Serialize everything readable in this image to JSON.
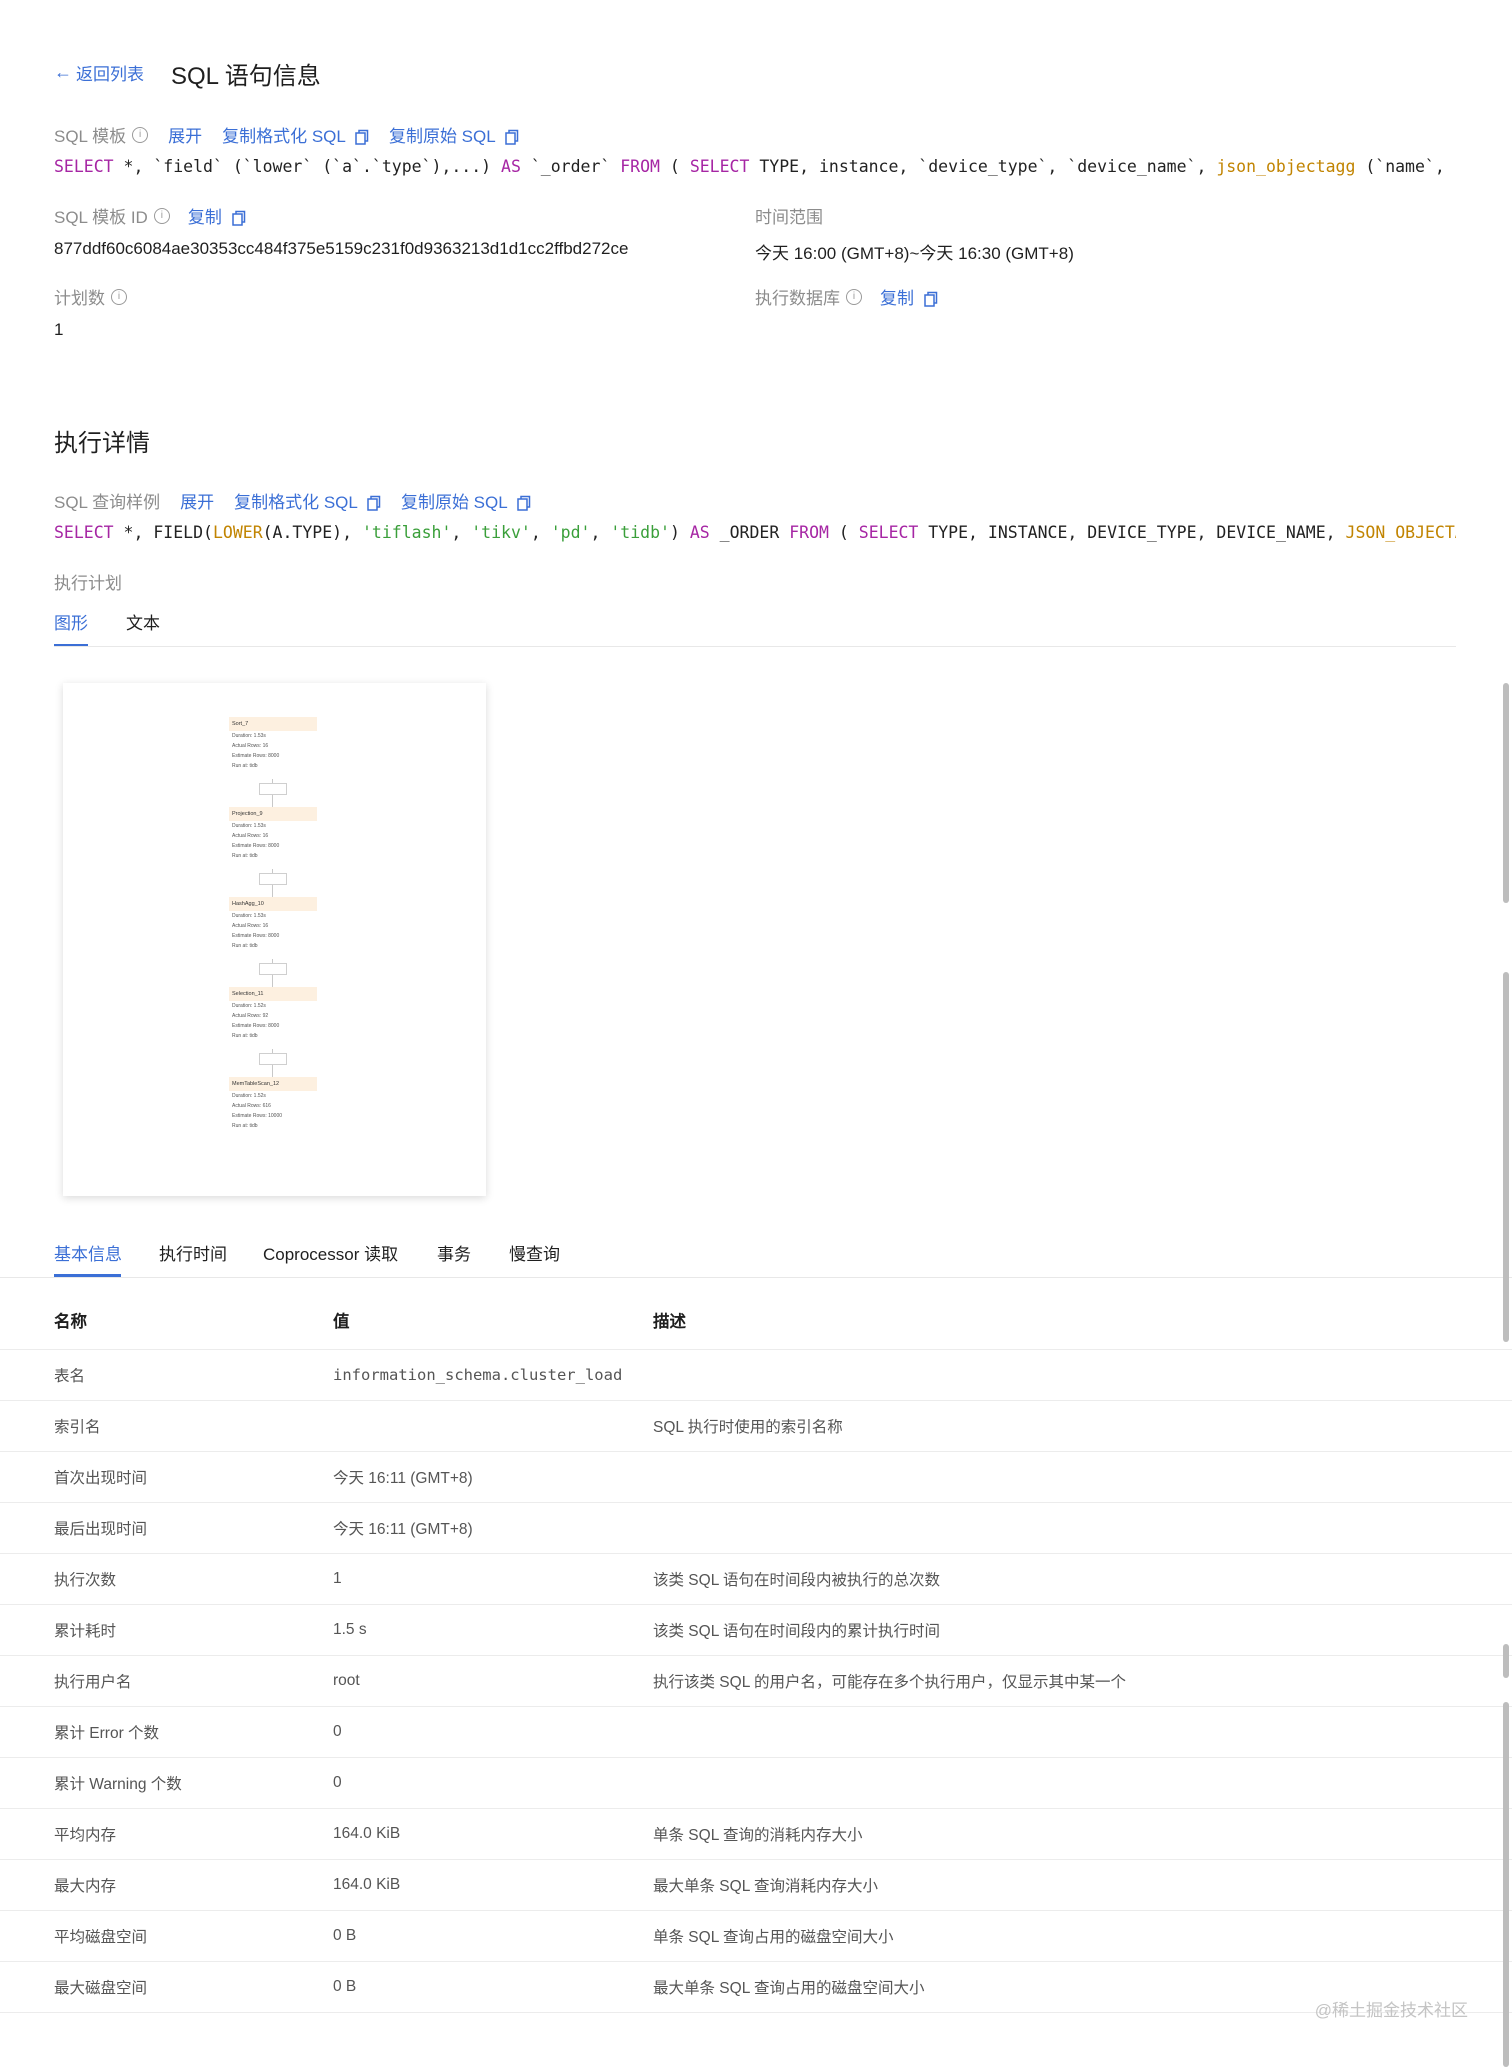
{
  "header": {
    "back_label": "返回列表",
    "title": "SQL 语句信息"
  },
  "template": {
    "label": "SQL 模板",
    "expand": "展开",
    "copy_formatted": "复制格式化 SQL",
    "copy_raw": "复制原始 SQL"
  },
  "template_sql": [
    {
      "t": "SELECT",
      "c": "kw"
    },
    {
      "t": " *, `field` (`lower` (`a`.`type`),...) ",
      "c": ""
    },
    {
      "t": "AS",
      "c": "kw"
    },
    {
      "t": " `_order` ",
      "c": ""
    },
    {
      "t": "FROM",
      "c": "kw"
    },
    {
      "t": " ( ",
      "c": ""
    },
    {
      "t": "SELECT",
      "c": "kw"
    },
    {
      "t": " TYPE, instance, `device_type`, `device_name`, ",
      "c": ""
    },
    {
      "t": "json_objectagg",
      "c": "fn"
    },
    {
      "t": " (`name`, ",
      "c": ""
    }
  ],
  "meta": {
    "template_id_label": "SQL 模板 ID",
    "template_id_copy": "复制",
    "template_id_value": "877ddf60c6084ae30353cc484f375e5159c231f0d9363213d1d1cc2ffbd272ce",
    "time_range_label": "时间范围",
    "time_range_value": "今天 16:00 (GMT+8)~今天 16:30 (GMT+8)",
    "plan_count_label": "计划数",
    "plan_count_value": "1",
    "exec_db_label": "执行数据库",
    "exec_db_copy": "复制"
  },
  "detail": {
    "title": "执行详情",
    "sample_label": "SQL 查询样例",
    "expand": "展开",
    "copy_formatted": "复制格式化 SQL",
    "copy_raw": "复制原始 SQL",
    "plan_label": "执行计划",
    "tab_graph": "图形",
    "tab_text": "文本"
  },
  "sample_sql": [
    {
      "t": "SELECT",
      "c": "kw"
    },
    {
      "t": " *, FIELD(",
      "c": ""
    },
    {
      "t": "LOWER",
      "c": "fn"
    },
    {
      "t": "(A.TYPE), ",
      "c": ""
    },
    {
      "t": "'tiflash'",
      "c": "str"
    },
    {
      "t": ", ",
      "c": ""
    },
    {
      "t": "'tikv'",
      "c": "str"
    },
    {
      "t": ", ",
      "c": ""
    },
    {
      "t": "'pd'",
      "c": "str"
    },
    {
      "t": ", ",
      "c": ""
    },
    {
      "t": "'tidb'",
      "c": "str"
    },
    {
      "t": ") ",
      "c": ""
    },
    {
      "t": "AS",
      "c": "kw"
    },
    {
      "t": " _ORDER ",
      "c": ""
    },
    {
      "t": "FROM",
      "c": "kw"
    },
    {
      "t": " ( ",
      "c": ""
    },
    {
      "t": "SELECT",
      "c": "kw"
    },
    {
      "t": " TYPE, INSTANCE, DEVICE_TYPE, DEVICE_NAME, ",
      "c": ""
    },
    {
      "t": "JSON_OBJECTAGG",
      "c": "fn"
    }
  ],
  "plan_nodes": [
    {
      "name": "Sort_7",
      "lines": [
        "Duration: 1.53s",
        "Actual Rows: 16",
        "Estimate Rows: 8000",
        "Run at: tidb"
      ]
    },
    {
      "name": "Projection_9",
      "lines": [
        "Duration: 1.53s",
        "Actual Rows: 16",
        "Estimate Rows: 8000",
        "Run at: tidb"
      ]
    },
    {
      "name": "HashAgg_10",
      "lines": [
        "Duration: 1.53s",
        "Actual Rows: 16",
        "Estimate Rows: 8000",
        "Run at: tidb"
      ]
    },
    {
      "name": "Selection_11",
      "lines": [
        "Duration: 1.52s",
        "Actual Rows: 92",
        "Estimate Rows: 8000",
        "Run at: tidb"
      ]
    },
    {
      "name": "MemTableScan_12",
      "lines": [
        "Duration: 1.52s",
        "Actual Rows: 616",
        "Estimate Rows: 10000",
        "Run at: tidb"
      ]
    }
  ],
  "info_tabs": [
    "基本信息",
    "执行时间",
    "Coprocessor 读取",
    "事务",
    "慢查询"
  ],
  "table": {
    "headers": [
      "名称",
      "值",
      "描述"
    ],
    "rows": [
      [
        "表名",
        "information_schema.cluster_load",
        ""
      ],
      [
        "索引名",
        "",
        "SQL 执行时使用的索引名称"
      ],
      [
        "首次出现时间",
        "今天 16:11 (GMT+8)",
        ""
      ],
      [
        "最后出现时间",
        "今天 16:11 (GMT+8)",
        ""
      ],
      [
        "执行次数",
        "1",
        "该类 SQL 语句在时间段内被执行的总次数"
      ],
      [
        "累计耗时",
        "1.5 s",
        "该类 SQL 语句在时间段内的累计执行时间"
      ],
      [
        "执行用户名",
        "root",
        "执行该类 SQL 的用户名，可能存在多个执行用户，仅显示其中某一个"
      ],
      [
        "累计 Error 个数",
        "0",
        ""
      ],
      [
        "累计 Warning 个数",
        "0",
        ""
      ],
      [
        "平均内存",
        "164.0 KiB",
        "单条 SQL 查询的消耗内存大小"
      ],
      [
        "最大内存",
        "164.0 KiB",
        "最大单条 SQL 查询消耗内存大小"
      ],
      [
        "平均磁盘空间",
        "0 B",
        "单条 SQL 查询占用的磁盘空间大小"
      ],
      [
        "最大磁盘空间",
        "0 B",
        "最大单条 SQL 查询占用的磁盘空间大小"
      ]
    ]
  },
  "watermark": "@稀土掘金技术社区"
}
